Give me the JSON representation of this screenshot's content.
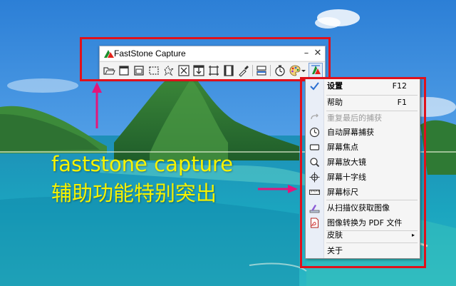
{
  "window": {
    "title": "FastStone Capture",
    "minimize_glyph": "–",
    "close_glyph": "✕"
  },
  "toolbar": {
    "tools": [
      {
        "icon": "open-folder-icon"
      },
      {
        "icon": "capture-window-icon"
      },
      {
        "icon": "capture-object-icon"
      },
      {
        "icon": "capture-rectangle-icon"
      },
      {
        "icon": "capture-freehand-icon"
      },
      {
        "icon": "capture-fullscreen-icon"
      },
      {
        "icon": "capture-scrolling-icon"
      },
      {
        "icon": "capture-fixed-region-icon"
      },
      {
        "icon": "capture-video-icon"
      },
      {
        "icon": "color-picker-icon"
      },
      {
        "icon": "output-icon"
      },
      {
        "icon": "timer-icon"
      },
      {
        "icon": "palette-icon"
      },
      {
        "icon": "menu-logo-icon"
      }
    ]
  },
  "menu": {
    "items": [
      {
        "label": "设置",
        "shortcut": "F12",
        "icon": "settings-icon",
        "bold": true
      },
      {
        "label": "帮助",
        "shortcut": "F1",
        "icon": ""
      },
      {
        "label": "重复最后的捕获",
        "shortcut": "",
        "icon": "repeat-icon",
        "disabled": true
      },
      {
        "label": "自动屏幕捕获",
        "shortcut": "",
        "icon": "clock-icon"
      },
      {
        "label": "屏幕焦点",
        "shortcut": "",
        "icon": "focus-icon"
      },
      {
        "label": "屏幕放大镜",
        "shortcut": "",
        "icon": "magnifier-icon"
      },
      {
        "label": "屏幕十字线",
        "shortcut": "",
        "icon": "crosshair-icon"
      },
      {
        "label": "屏幕标尺",
        "shortcut": "",
        "icon": "ruler-icon"
      },
      {
        "label": "从扫描仪获取图像",
        "shortcut": "",
        "icon": "scanner-icon"
      },
      {
        "label": "图像转换为 PDF 文件",
        "shortcut": "",
        "icon": "pdf-icon"
      },
      {
        "label": "皮肤",
        "shortcut": "",
        "icon": "",
        "submenu": "▸"
      },
      {
        "label": "关于",
        "shortcut": "",
        "icon": ""
      }
    ]
  },
  "caption": {
    "line1": "faststone capture",
    "line2": "辅助功能特别突出"
  },
  "colors": {
    "highlight_box": "#e0111b",
    "arrow": "#e3167b",
    "caption_text": "#f6f200"
  }
}
